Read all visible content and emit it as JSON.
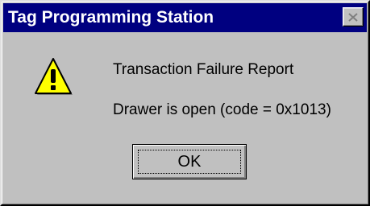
{
  "window": {
    "title": "Tag Programming Station",
    "close_icon": "close-icon"
  },
  "message": {
    "icon": "warning-icon",
    "heading": "Transaction Failure Report",
    "detail": "Drawer is open (code = 0x1013)"
  },
  "buttons": {
    "ok_label": "OK"
  },
  "colors": {
    "titlebar": "#000080",
    "dialog_face": "#c0c0c0",
    "warning_fill": "#ffff00"
  }
}
